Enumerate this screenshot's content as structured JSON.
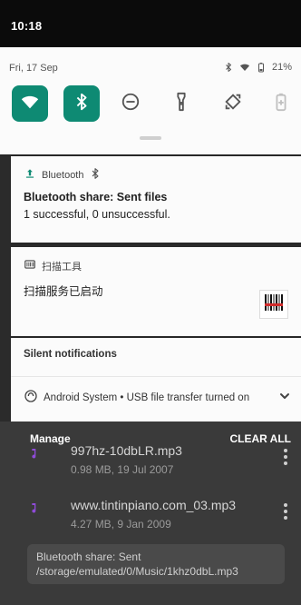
{
  "status_bar": {
    "time": "10:18"
  },
  "quick_settings": {
    "date": "Fri, 17 Sep",
    "battery": "21%",
    "accent_color": "#0e8a73",
    "tiles": [
      {
        "icon": "wifi-icon",
        "state": "on"
      },
      {
        "icon": "bluetooth-icon",
        "state": "on"
      },
      {
        "icon": "dnd-icon",
        "state": "off"
      },
      {
        "icon": "flashlight-icon",
        "state": "off"
      },
      {
        "icon": "rotate-icon",
        "state": "off"
      },
      {
        "icon": "battery-saver-icon",
        "state": "disabled"
      }
    ]
  },
  "notifications": {
    "bluetooth": {
      "app": "Bluetooth",
      "title": "Bluetooth share: Sent files",
      "text": "1 successful, 0 unsuccessful."
    },
    "scanner": {
      "app": "扫描工具",
      "text": "扫描服务已启动"
    },
    "silent": {
      "section_label": "Silent notifications",
      "text": "Android System • USB file transfer turned on"
    }
  },
  "background_list": {
    "manage_label": "Manage",
    "clear_all_label": "CLEAR ALL",
    "items": [
      {
        "name": "997hz-10dbLR.mp3",
        "meta": "0.98 MB, 19 Jul 2007"
      },
      {
        "name": "www.tintinpiano.com_03.mp3",
        "meta": "4.27 MB, 9 Jan 2009"
      }
    ],
    "toast": "Bluetooth share: Sent /storage/emulated/0/Music/1khz0dbL.mp3"
  }
}
